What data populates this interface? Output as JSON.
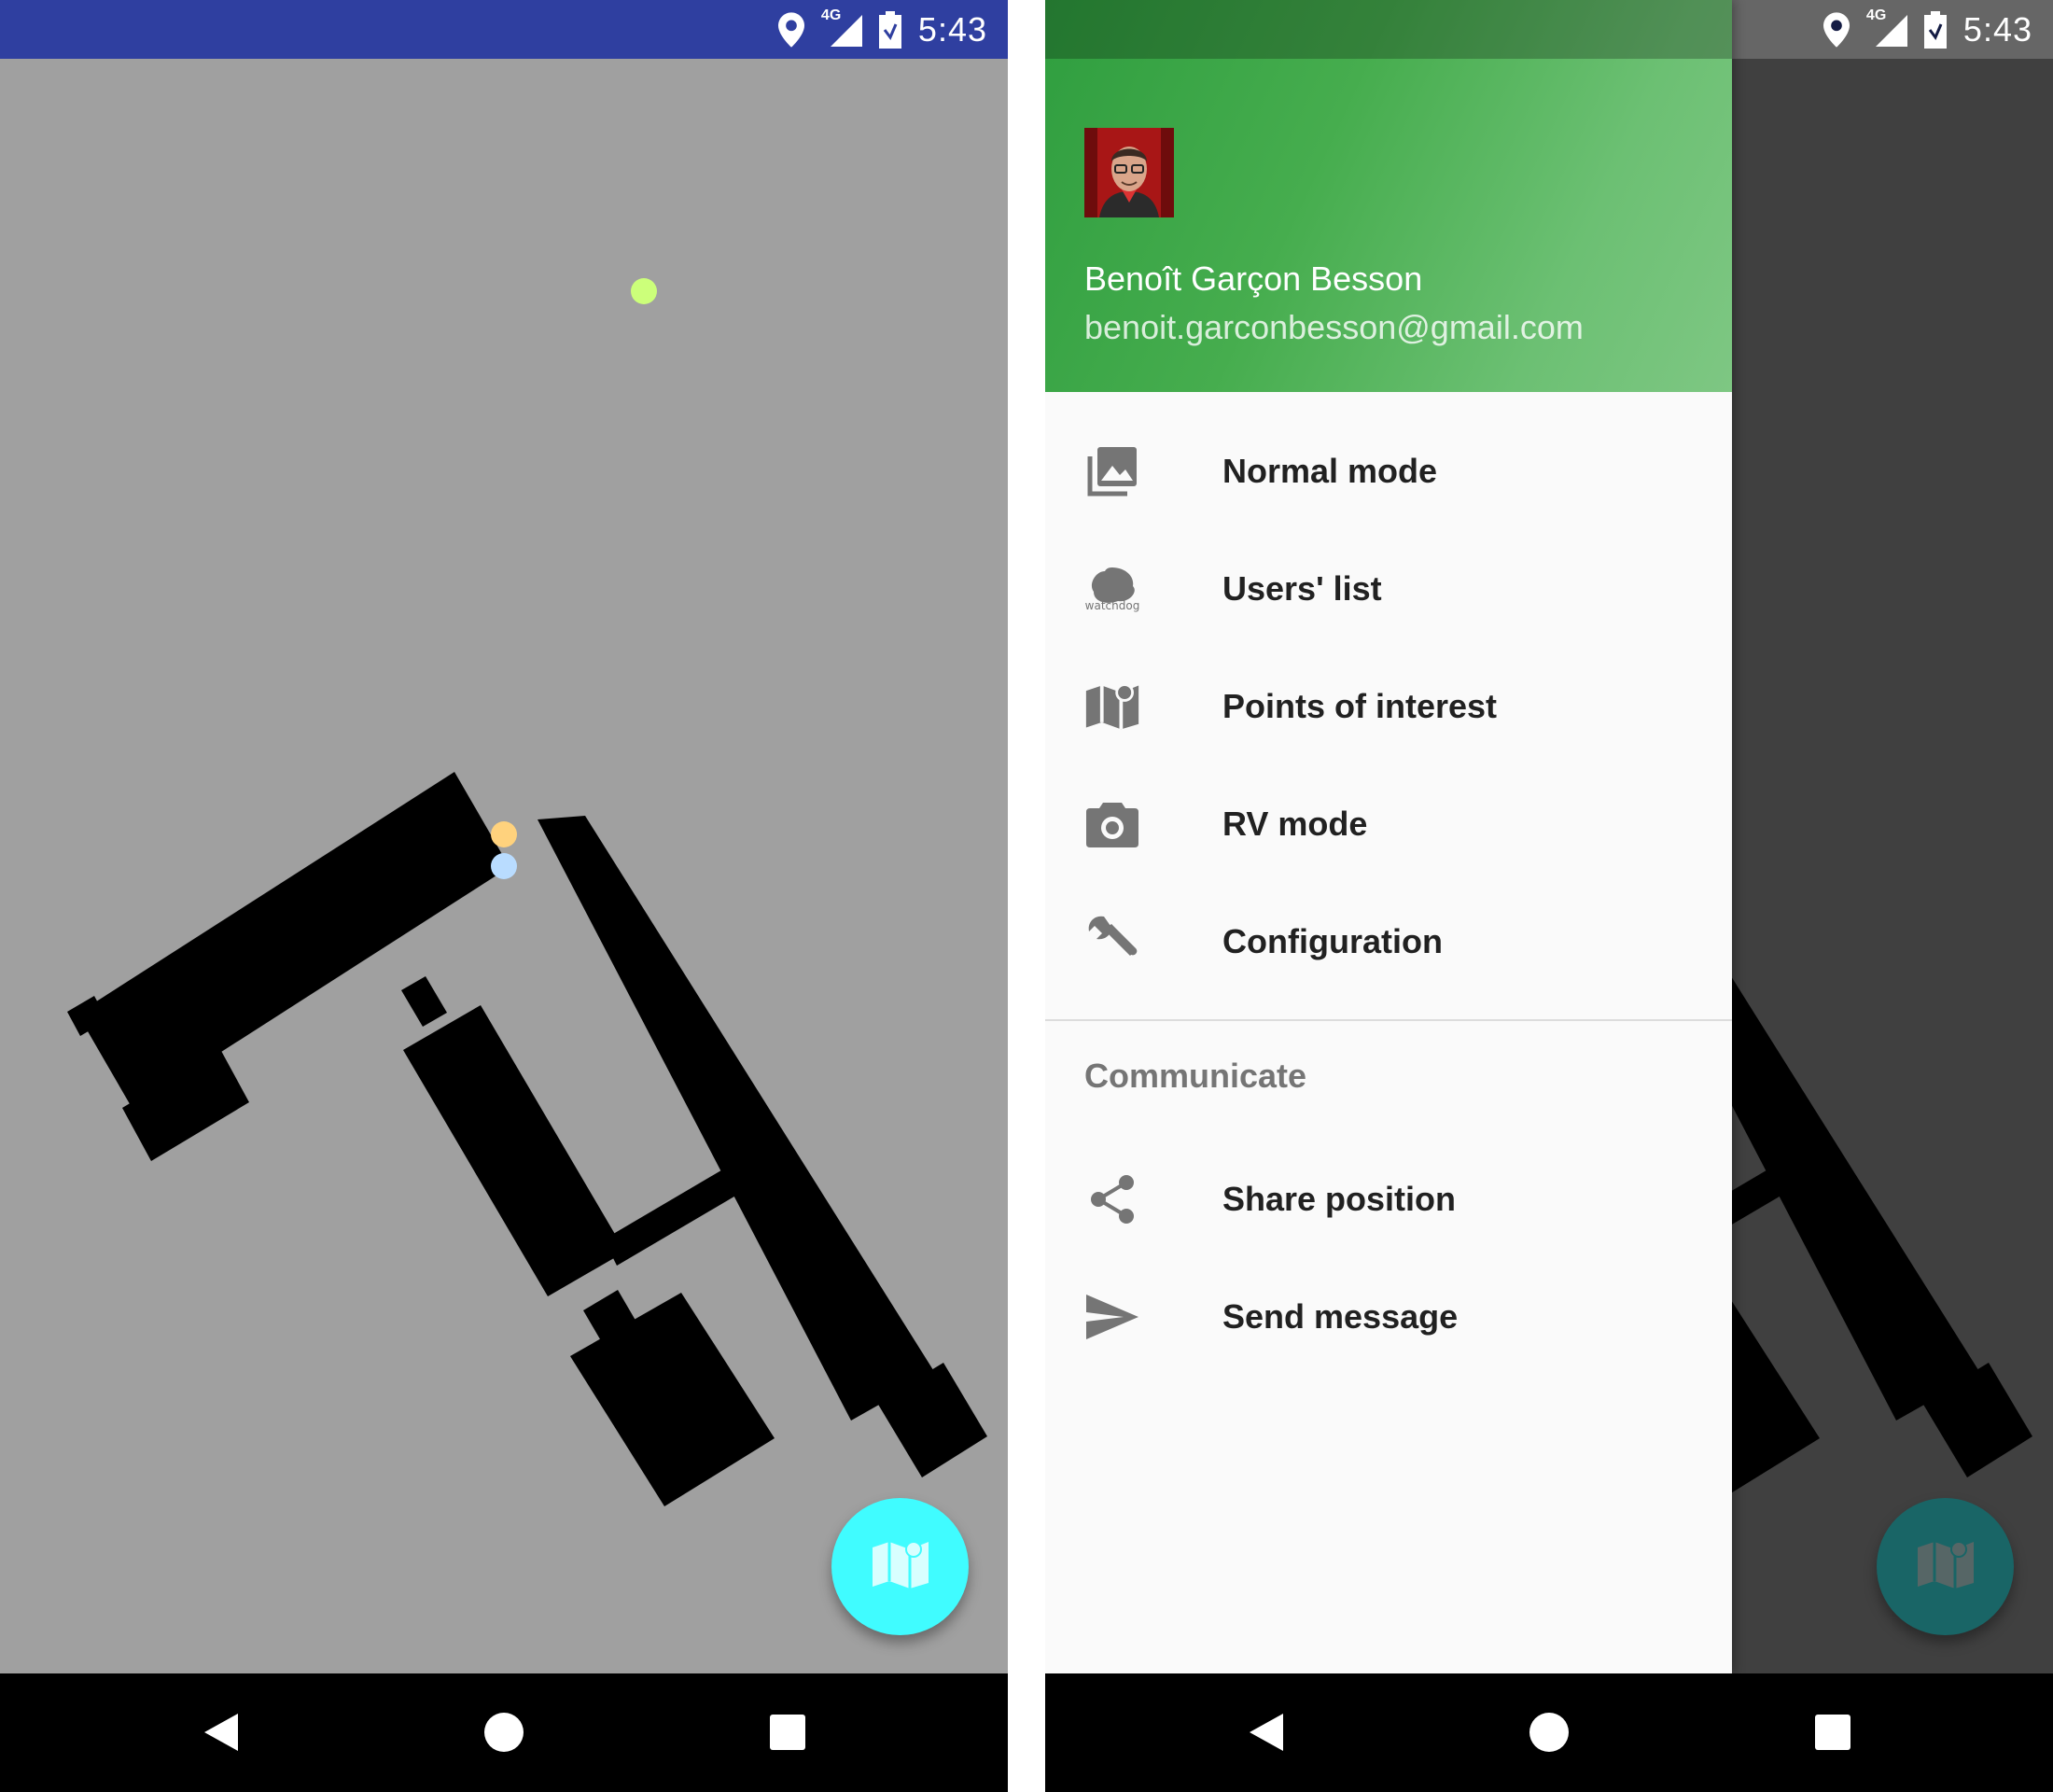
{
  "status_bar": {
    "time": "5:43",
    "network": "4G"
  },
  "colors": {
    "status_bar_left": "#2f3fa0",
    "status_bar_right": "#141c44",
    "map_bg": "#a0a0a0",
    "fab": "#40fcff",
    "header_green": "#4caf50"
  },
  "map": {
    "markers": [
      {
        "name": "green-marker",
        "color": "#ccff7a"
      },
      {
        "name": "orange-marker",
        "color": "#ffd27d"
      },
      {
        "name": "blue-marker",
        "color": "#b9dcff"
      }
    ]
  },
  "fab": {
    "icon": "map-pin-icon"
  },
  "navigation_bar": {
    "buttons": [
      "back",
      "home",
      "recents"
    ]
  },
  "drawer": {
    "user_name": "Benoît Garçon Besson",
    "user_email": "benoit.garconbesson@gmail.com",
    "items": [
      {
        "label": "Normal mode",
        "icon": "photo-library-icon"
      },
      {
        "label": "Users' list",
        "icon": "watchdog-logo-icon",
        "logo_text": "watchdog"
      },
      {
        "label": "Points of interest",
        "icon": "map-pin-icon"
      },
      {
        "label": "RV mode",
        "icon": "camera-icon"
      },
      {
        "label": "Configuration",
        "icon": "wrench-icon"
      }
    ],
    "section_title": "Communicate",
    "communicate_items": [
      {
        "label": "Share position",
        "icon": "share-icon"
      },
      {
        "label": "Send message",
        "icon": "send-icon"
      }
    ]
  }
}
